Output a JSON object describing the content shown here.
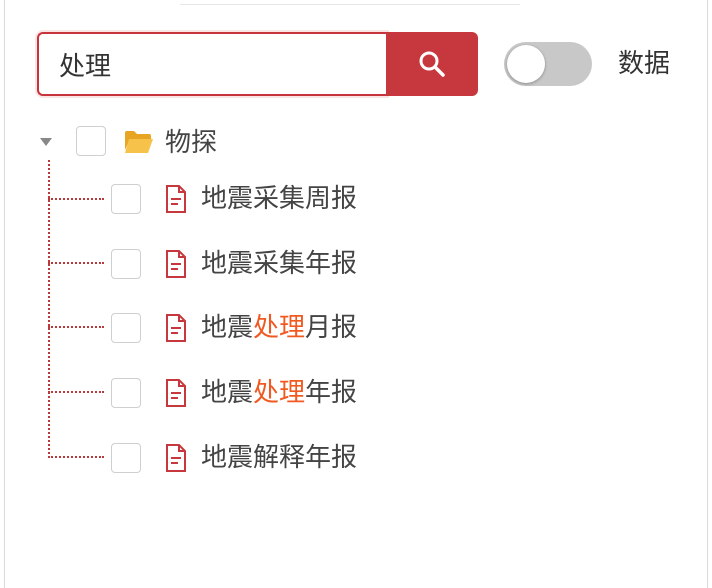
{
  "search": {
    "value": "处理",
    "placeholder": "",
    "button_icon": "search-icon"
  },
  "toggle": {
    "label": "数据",
    "state": "off"
  },
  "tree": {
    "root": {
      "label": "物探",
      "icon": "folder-open-icon",
      "expanded": true
    },
    "children": [
      {
        "pre": "地震采集周报",
        "match": "",
        "post": "",
        "icon": "document-icon"
      },
      {
        "pre": "地震采集年报",
        "match": "",
        "post": "",
        "icon": "document-icon"
      },
      {
        "pre": "地震",
        "match": "处理",
        "post": "月报",
        "icon": "document-icon"
      },
      {
        "pre": "地震",
        "match": "处理",
        "post": "年报",
        "icon": "document-icon"
      },
      {
        "pre": "地震解释年报",
        "match": "",
        "post": "",
        "icon": "document-icon"
      }
    ]
  },
  "colors": {
    "accent": "#c7373e",
    "highlight": "#f05a22",
    "folder": "#f5b530",
    "toggle_off": "#c8c8c8"
  }
}
